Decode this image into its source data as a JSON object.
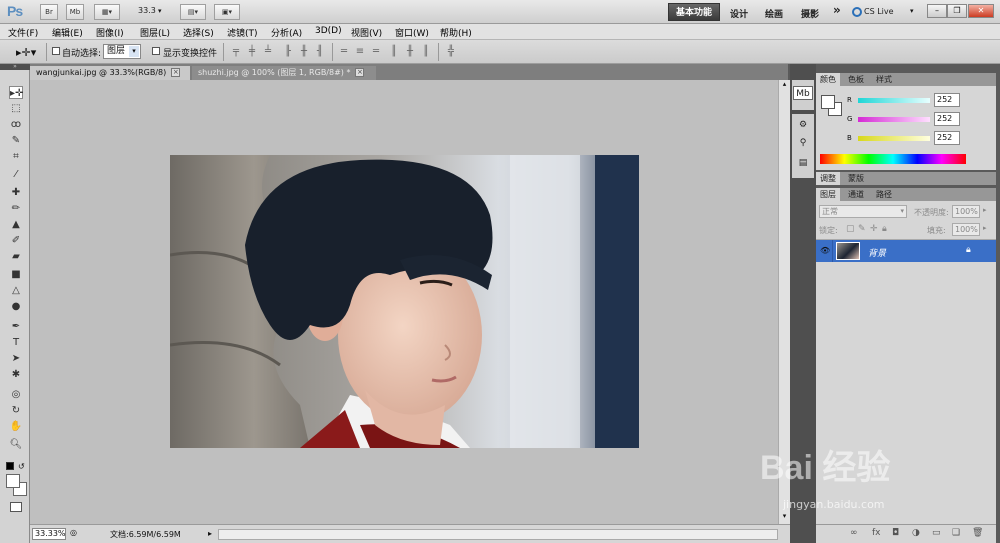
{
  "appbar": {
    "logo": "Ps",
    "bridge": "Br",
    "minibridge": "Mb",
    "zoom": "33.3",
    "workspaces": [
      "设计",
      "绘画",
      "摄影"
    ],
    "active_workspace": "基本功能",
    "more": "»",
    "cslive": "CS Live"
  },
  "menu": [
    "文件(F)",
    "编辑(E)",
    "图像(I)",
    "图层(L)",
    "选择(S)",
    "滤镜(T)",
    "分析(A)",
    "3D(D)",
    "视图(V)",
    "窗口(W)",
    "帮助(H)"
  ],
  "options": {
    "auto_select_label": "自动选择:",
    "auto_select_value": "图层",
    "show_transform_label": "显示变换控件"
  },
  "tabs": [
    {
      "label": "wangjunkai.jpg @ 33.3%(RGB/8)",
      "close": "×"
    },
    {
      "label": "shuzhi.jpg @ 100% (图层 1, RGB/8#) *",
      "close": "×"
    }
  ],
  "status": {
    "zoom": "33.33%",
    "doc": "文档:6.59M/6.59M"
  },
  "color_panel": {
    "tabs": [
      "颜色",
      "色板",
      "样式"
    ],
    "channels": [
      {
        "label": "R",
        "value": "252",
        "color": "#20d6d6"
      },
      {
        "label": "G",
        "value": "252",
        "color": "#d63ad6"
      },
      {
        "label": "B",
        "value": "252",
        "color": "#d6d620"
      }
    ]
  },
  "adjust_panel": {
    "tabs": [
      "调整",
      "蒙版"
    ]
  },
  "layers_panel": {
    "tabs": [
      "图层",
      "通道",
      "路径"
    ],
    "blend_mode": "正常",
    "opacity_label": "不透明度:",
    "opacity_value": "100%",
    "lock_label": "锁定:",
    "fill_label": "填充:",
    "fill_value": "100%",
    "layers": [
      {
        "name": "背景"
      }
    ]
  },
  "watermark": {
    "main": "Bai 经验",
    "url": "jingyan.baidu.com"
  },
  "colors": {
    "accent": "#3a6fc7",
    "workspace_active": "#4a4a4a"
  }
}
